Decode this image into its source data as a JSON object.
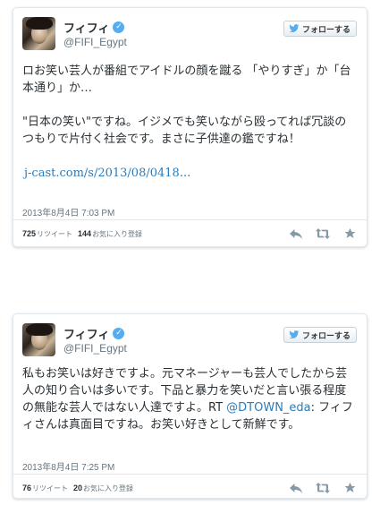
{
  "tweets": [
    {
      "display_name": "フィフィ",
      "handle": "@FIFI_Egypt",
      "follow_label": "フォローする",
      "text_paragraphs": [
        "ロお笑い芸人が番組でアイドルの顔を蹴る 「やりすぎ」か「台本通り」か…",
        "\"日本の笑い\"ですね。イジメでも笑いながら殴ってれば冗談のつもりで片付く社会です。まさに子供達の鑑ですね！"
      ],
      "link_text": "j-cast.com/s/2013/08/0418...",
      "timestamp": "2013年8月4日 7:03 PM",
      "retweet_count": "725",
      "retweet_label": "リツイート",
      "favorite_count": "144",
      "favorite_label": "お気に入り登録"
    },
    {
      "display_name": "フィフィ",
      "handle": "@FIFI_Egypt",
      "follow_label": "フォローする",
      "text_main": "私もお笑いは好きですよ。元マネージャーも芸人でしたから芸人の知り合いは多いです。下品と暴力を笑いだと言い張る程度の無能な芸人ではない人達ですよ。RT ",
      "mention": "@DTOWN_eda",
      "text_after": ": フィフィさんは真面目ですね。お笑い好きとして新鮮です。",
      "timestamp": "2013年8月4日 7:25 PM",
      "retweet_count": "76",
      "retweet_label": "リツイート",
      "favorite_count": "20",
      "favorite_label": "お気に入り登録"
    }
  ],
  "icons": {
    "verified": "verified-badge-icon",
    "bird": "twitter-bird-icon",
    "reply": "reply-icon",
    "retweet": "retweet-icon",
    "favorite": "star-icon"
  },
  "colors": {
    "link": "#2b7bb9",
    "verified": "#55acee",
    "icon": "#8899a6"
  }
}
